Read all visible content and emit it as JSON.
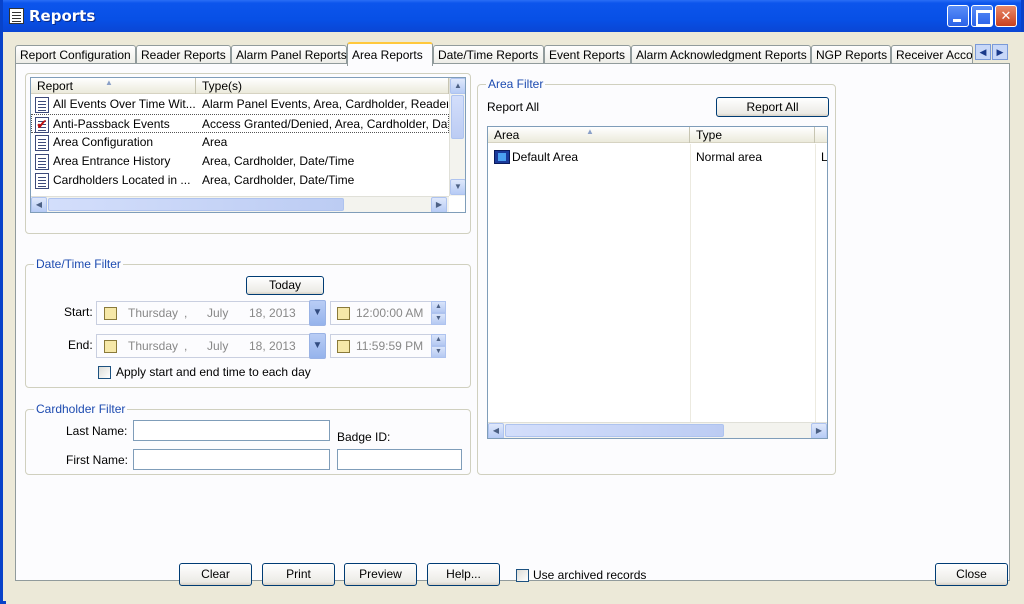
{
  "window": {
    "title": "Reports"
  },
  "tabs": [
    {
      "label": "Report Configuration"
    },
    {
      "label": "Reader Reports"
    },
    {
      "label": "Alarm Panel Reports"
    },
    {
      "label": "Area Reports"
    },
    {
      "label": "Date/Time Reports"
    },
    {
      "label": "Event Reports"
    },
    {
      "label": "Alarm Acknowledgment Reports"
    },
    {
      "label": "NGP Reports"
    },
    {
      "label": "Receiver Acco"
    }
  ],
  "report_list": {
    "headers": {
      "report": "Report",
      "types": "Type(s)"
    },
    "rows": [
      {
        "report": "All Events Over Time Wit...",
        "types": "Alarm Panel Events, Area, Cardholder, Reader"
      },
      {
        "report": "Anti-Passback Events",
        "types": "Access Granted/Denied, Area, Cardholder, Dat"
      },
      {
        "report": "Area Configuration",
        "types": "Area"
      },
      {
        "report": "Area Entrance History",
        "types": "Area, Cardholder, Date/Time"
      },
      {
        "report": "Cardholders Located in ...",
        "types": "Area, Cardholder, Date/Time"
      }
    ]
  },
  "datetime_filter": {
    "legend": "Date/Time Filter",
    "today_label": "Today",
    "start_label": "Start:",
    "end_label": "End:",
    "start": {
      "weekday": "Thursday",
      "sep": ",",
      "month": "July",
      "day_year": "18, 2013",
      "time": "12:00:00 AM"
    },
    "end": {
      "weekday": "Thursday",
      "sep": ",",
      "month": "July",
      "day_year": "18, 2013",
      "time": "11:59:59 PM"
    },
    "apply_label": "Apply start and end time to each day"
  },
  "cardholder_filter": {
    "legend": "Cardholder Filter",
    "last_name_label": "Last Name:",
    "first_name_label": "First Name:",
    "badge_label": "Badge ID:",
    "last_name_value": "",
    "first_name_value": "",
    "badge_value": ""
  },
  "area_filter": {
    "legend": "Area Filter",
    "report_all_text": "Report All",
    "report_all_button": "Report All",
    "headers": {
      "area": "Area",
      "type": "Type",
      "extra": ""
    },
    "rows": [
      {
        "area": "Default Area",
        "type": "Normal area",
        "extra": "L"
      }
    ]
  },
  "footer": {
    "clear": "Clear",
    "print": "Print",
    "preview": "Preview",
    "help": "Help...",
    "archived": "Use archived records",
    "close": "Close"
  }
}
